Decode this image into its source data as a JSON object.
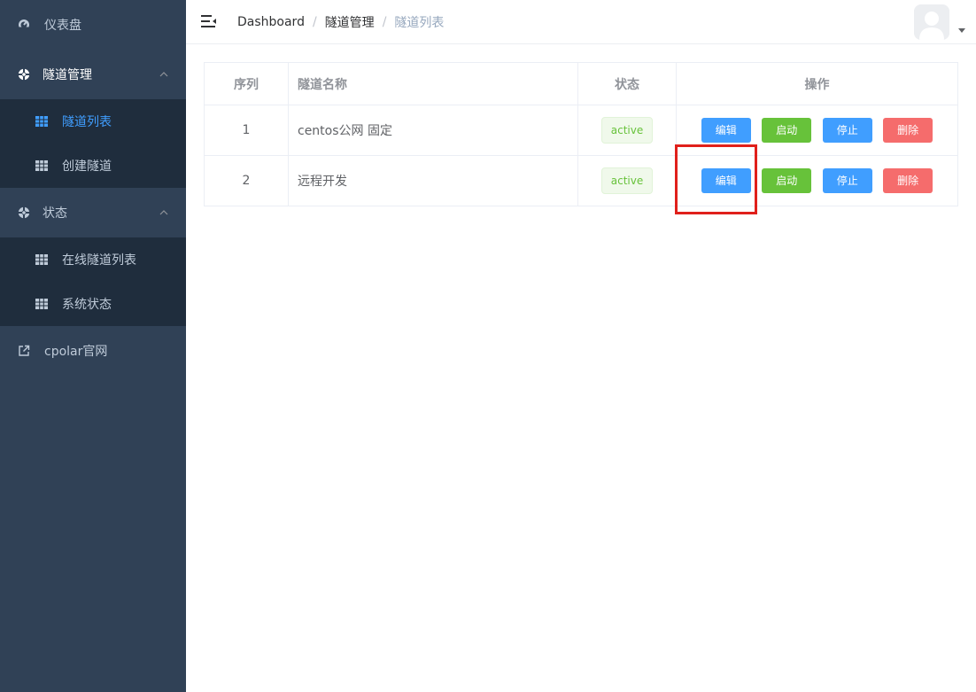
{
  "colors": {
    "sidebar_bg": "#304156",
    "submenu_bg": "#1f2d3d",
    "accent": "#409eff",
    "success": "#67c23a",
    "danger": "#f56c6c",
    "highlight": "#e0201b"
  },
  "sidebar": {
    "dashboard": {
      "label": "仪表盘",
      "icon": "speedometer-icon"
    },
    "tunnel_group": {
      "label": "隧道管理",
      "icon": "lifebuoy-icon",
      "items": [
        {
          "label": "隧道列表",
          "icon": "table-icon",
          "active": true
        },
        {
          "label": "创建隧道",
          "icon": "table-icon"
        }
      ]
    },
    "status_group": {
      "label": "状态",
      "icon": "lifebuoy-icon",
      "items": [
        {
          "label": "在线隧道列表",
          "icon": "table-icon"
        },
        {
          "label": "系统状态",
          "icon": "table-icon"
        }
      ]
    },
    "website": {
      "label": "cpolar官网",
      "icon": "external-link-icon"
    }
  },
  "navbar": {
    "breadcrumb": [
      "Dashboard",
      "隧道管理",
      "隧道列表"
    ],
    "separator": "/"
  },
  "table": {
    "headers": [
      "序列",
      "隧道名称",
      "状态",
      "操作"
    ],
    "rows": [
      {
        "index": "1",
        "name": "centos公网 固定",
        "status": "active"
      },
      {
        "index": "2",
        "name": "远程开发",
        "status": "active"
      }
    ],
    "actions": {
      "edit": "编辑",
      "start": "启动",
      "stop": "停止",
      "delete": "删除"
    }
  }
}
